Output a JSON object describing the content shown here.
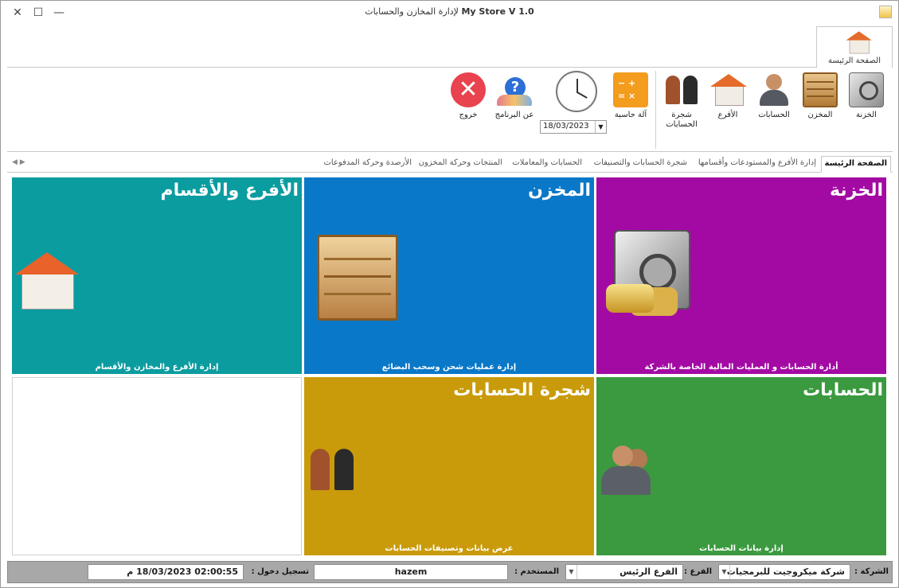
{
  "window": {
    "title_bold": "My Store V 1.0",
    "title_rest": "لإدارة المخازن والحسابات",
    "close_glyph": "✕",
    "maximize_glyph": "☐",
    "minimize_glyph": "—"
  },
  "ribbon": {
    "tab": {
      "label": "الصفحة الرئيسة",
      "icon": "home-icon"
    },
    "items": [
      {
        "label": "الخزنة",
        "icon": "safe-icon"
      },
      {
        "label": "المخزن",
        "icon": "box-icon"
      },
      {
        "label": "الحسابات",
        "icon": "accounts-icon"
      },
      {
        "label": "الأفرع",
        "icon": "house-icon"
      },
      {
        "label": "شجرة الحسابات",
        "icon": "accounts-tree-icon"
      },
      {
        "label": "آلة حاسبة",
        "icon": "calculator-icon"
      },
      {
        "label": "عن البرنامج",
        "icon": "about-icon"
      },
      {
        "label": "خروج",
        "icon": "exit-icon"
      }
    ],
    "date_value": "18/03/2023"
  },
  "doc_tabs": [
    "الصفحة الرئيسة",
    "إدارة الأفرع والمستودعات وأقسامها",
    "شجرة الحسابات والتصنيفات",
    "الحسابات والمعاملات",
    "المنتجات وحركة المخزون",
    "الأرصدة وحركة المدفوعات"
  ],
  "tiles": [
    {
      "title": "الخزنة",
      "desc": "أدارة الحسابات و العمليات المالية الخاصة بالشركة",
      "color": "#a30aa3",
      "icon": "safe-icon"
    },
    {
      "title": "المخزن",
      "desc": "إدارة عمليات شحن وسحب البضائع",
      "color": "#0a78c8",
      "icon": "box-icon"
    },
    {
      "title": "الأفرع  والأقسام",
      "desc": "إدارة الأفرع والمخازن والأقسام",
      "color": "#0b9ca0",
      "icon": "house-icon"
    },
    {
      "title": "الحسابات",
      "desc": "إدارة بيانات الحسابات",
      "color": "#3b9a3f",
      "icon": "accounts-icon"
    },
    {
      "title": "شجرة  الحسابات",
      "desc": "عرض بيانات وتصنيفات الحسابات",
      "color": "#c99b0a",
      "icon": "accounts-tree-icon"
    }
  ],
  "status": {
    "company_label": "الشركة :",
    "company_value": "شركة ميكروجيت للبرمجيات",
    "branch_label": "الفرع :",
    "branch_value": "الفرع الرئيس",
    "user_label": "المستخدم :",
    "user_value": "hazem",
    "login_label": "تسجيل دخول :",
    "login_value": "02:00:55 18/03/2023 م"
  }
}
